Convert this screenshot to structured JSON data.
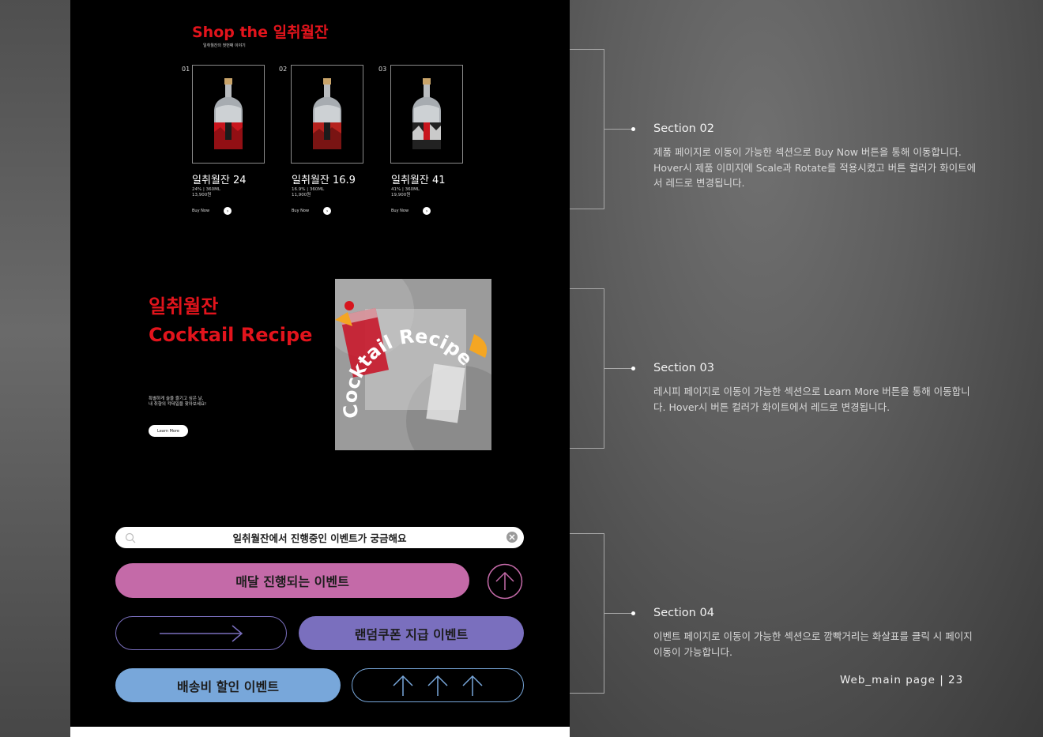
{
  "section02": {
    "title": "Shop the 일취월잔",
    "subtitle": "일취월잔의 첫번째 이야기",
    "products": [
      {
        "num": "01",
        "name": "일취월잔 24",
        "spec": "24%  |  360ML",
        "price": "13,900원",
        "buy": "Buy Now",
        "label_color": "#c8151d"
      },
      {
        "num": "02",
        "name": "일취월잔 16.9",
        "spec": "16.9%  |  360ML",
        "price": "11,900원",
        "buy": "Buy Now",
        "label_color": "#b5221e"
      },
      {
        "num": "03",
        "name": "일취월잔 41",
        "spec": "41%  |  360ML",
        "price": "19,900원",
        "buy": "Buy Now",
        "label_color": "#222222"
      }
    ]
  },
  "section03": {
    "title_line1": "일취월잔",
    "title_line2": "Cocktail Recipe",
    "desc_line1": "특별하게 술을 즐기고 싶은 날,",
    "desc_line2": "내 취향의 칵테일을 찾아보세요!",
    "learn_more": "Learn More",
    "image_text": "Cocktail Recipe"
  },
  "section04": {
    "search_text": "일취월잔에서 진행중인 이벤트가 궁금해요",
    "btn_monthly": "매달 진행되는 이벤트",
    "btn_coupon": "랜덤쿠폰 지급 이벤트",
    "btn_shipping": "배송비 할인 이벤트",
    "colors": {
      "pink": "#c46aa8",
      "purple": "#7a6fbe",
      "blue": "#78a7da"
    }
  },
  "descriptions": [
    {
      "title": "Section 02",
      "text": "제품 페이지로 이동이 가능한 섹션으로 Buy Now 버튼을 통해 이동합니다. Hover시 제품 이미지에 Scale과 Rotate를 적용시켰고 버튼 컬러가 화이트에서 레드로 변경됩니다."
    },
    {
      "title": "Section 03",
      "text": "레시피 페이지로 이동이 가능한 섹션으로 Learn More 버튼을 통해 이동합니다. Hover시 버튼 컬러가 화이트에서 레드로 변경됩니다."
    },
    {
      "title": "Section 04",
      "text": "이벤트 페이지로 이동이 가능한 섹션으로 깜빡거리는 화살표를 클릭 시 페이지 이동이 가능합니다."
    }
  ],
  "footer": "Web_main page  |  23",
  "accent": "#e2141c"
}
